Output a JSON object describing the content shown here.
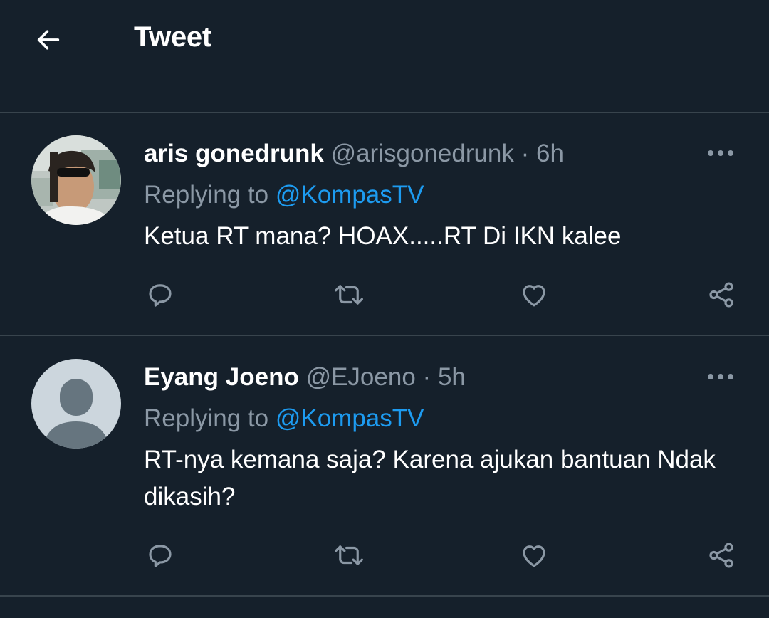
{
  "header": {
    "title": "Tweet",
    "back_icon": "arrow-left-icon"
  },
  "colors": {
    "background": "#15202b",
    "divider": "#38444d",
    "secondary_text": "#8b98a5",
    "mention": "#1d9bf0",
    "default_avatar_bg": "#ccd6dd",
    "default_avatar_fg": "#66757f"
  },
  "replies": [
    {
      "name": "aris gonedrunk",
      "handle": "@arisgonedrunk",
      "separator": "·",
      "time": "6h",
      "replying_prefix": "Replying to",
      "replying_to": "@KompasTV",
      "text": "Ketua RT mana? HOAX.....RT Di IKN kalee",
      "avatar": "user-photo-avatar",
      "actions": [
        "reply-icon",
        "retweet-icon",
        "like-icon",
        "share-icon"
      ]
    },
    {
      "name": "Eyang Joeno",
      "handle": "@EJoeno",
      "separator": "·",
      "time": "5h",
      "replying_prefix": "Replying to",
      "replying_to": "@KompasTV",
      "text": "RT-nya kemana saja? Karena ajukan bantuan Ndak dikasih?",
      "avatar": "default-avatar",
      "actions": [
        "reply-icon",
        "retweet-icon",
        "like-icon",
        "share-icon"
      ]
    }
  ]
}
